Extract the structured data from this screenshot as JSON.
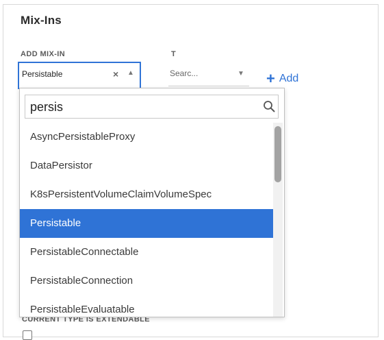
{
  "section_title": "Mix-Ins",
  "add_mixin": {
    "label": "ADD MIX-IN",
    "selected_value": "Persistable",
    "clear_icon": "×",
    "caret_icon": "▲"
  },
  "type_field": {
    "label": "T",
    "value": "Searc...",
    "caret_icon": "▼"
  },
  "add_button": {
    "icon": "+",
    "label": "Add"
  },
  "dropdown": {
    "search_value": "persis",
    "search_icon": "search-icon",
    "options": [
      "AsyncPersistableProxy",
      "DataPersistor",
      "K8sPersistentVolumeClaimVolumeSpec",
      "Persistable",
      "PersistableConnectable",
      "PersistableConnection",
      "PersistableEvaluatable"
    ],
    "selected_option": "Persistable"
  },
  "extendable_label": "CURRENT TYPE IS EXTENDABLE",
  "colors": {
    "accent": "#2f73d6",
    "selected_text": "#ffffff"
  }
}
